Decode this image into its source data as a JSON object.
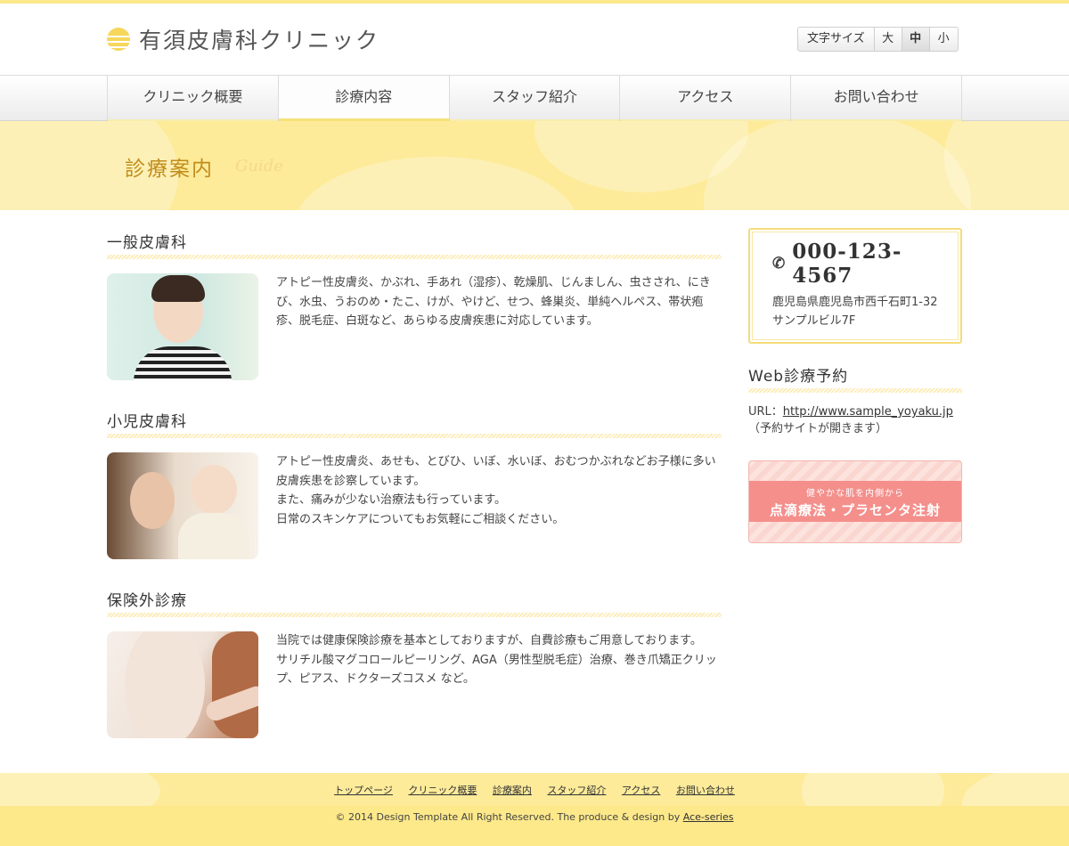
{
  "header": {
    "logo_text": "有須皮膚科クリニック",
    "font_size": {
      "label": "文字サイズ",
      "options": [
        "大",
        "中",
        "小"
      ],
      "selected": "中"
    }
  },
  "nav": {
    "items": [
      "クリニック概要",
      "診療内容",
      "スタッフ紹介",
      "アクセス",
      "お問い合わせ"
    ],
    "current": "診療内容"
  },
  "banner": {
    "title": "診療案内",
    "subtitle": "Guide"
  },
  "sections": [
    {
      "title": "一般皮膚科",
      "text": "アトピー性皮膚炎、かぶれ、手あれ（湿疹）、乾燥肌、じんましん、虫さされ、にきび、水虫、うおのめ・たこ、けが、やけど、せつ、蜂巣炎、単純ヘルペス、帯状疱疹、脱毛症、白斑など、あらゆる皮膚疾患に対応しています。"
    },
    {
      "title": "小児皮膚科",
      "text_lines": [
        "アトピー性皮膚炎、あせも、とびひ、いぼ、水いぼ、おむつかぶれなどお子様に多い皮膚疾患を診察しています。",
        "また、痛みが少ない治療法も行っています。",
        "日常のスキンケアについてもお気軽にご相談ください。"
      ]
    },
    {
      "title": "保険外診療",
      "text_lines": [
        "当院では健康保険診療を基本としておりますが、自費診療もご用意しております。",
        "サリチル酸マグコロールピーリング、AGA（男性型脱毛症）治療、巻き爪矯正クリップ、ピアス、ドクターズコスメ など。"
      ]
    }
  ],
  "sidebar": {
    "tel": "000-123-4567",
    "address_lines": [
      "鹿児島県鹿児島市西千石町1-32",
      "サンプルビル7F"
    ],
    "web_title": "Web診療予約",
    "url_label": "URL：",
    "url": "http://www.sample_yoyaku.jp",
    "url_note": "（予約サイトが開きます）",
    "promo_small": "健やかな肌を内側から",
    "promo_big": "点滴療法・プラセンタ注射"
  },
  "footer": {
    "links": [
      "トップページ",
      "クリニック概要",
      "診療案内",
      "スタッフ紹介",
      "アクセス",
      "お問い合わせ"
    ],
    "copyright": "© 2014 Design Template All Right Reserved. The produce & design by ",
    "credit": "Ace-series"
  },
  "colors": {
    "accent_yellow": "#fdeb9a",
    "heading_gold": "#c18c1a",
    "promo_pink": "#f48f8c"
  }
}
